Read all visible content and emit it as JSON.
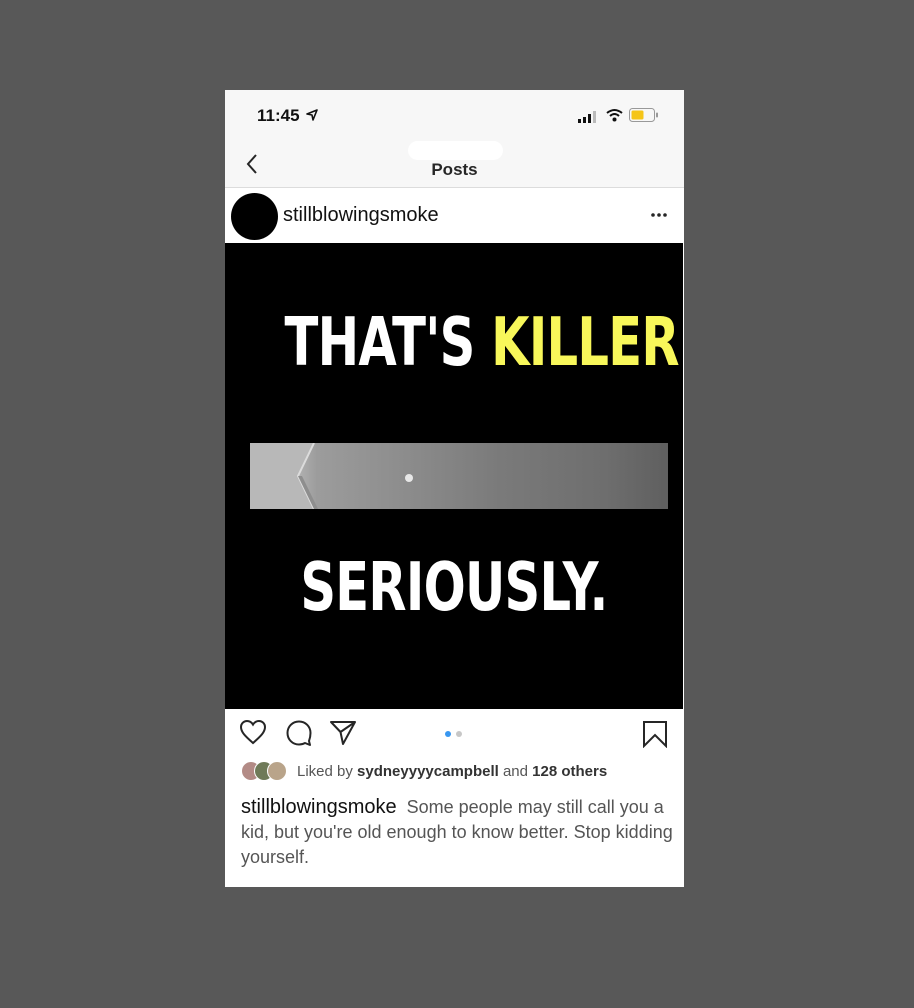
{
  "status_bar": {
    "time": "11:45"
  },
  "nav": {
    "title": "Posts"
  },
  "post": {
    "username": "stillblowingsmoke",
    "image": {
      "headline_part1": "THAT'S ",
      "headline_highlight": "KILLER",
      "headline_end": ".",
      "headline2": "SERIOUSLY."
    },
    "likes": {
      "prefix": "Liked by ",
      "user": "sydneyyyycampbell",
      "middle": " and ",
      "others": "128 others"
    },
    "caption": {
      "user": "stillblowingsmoke",
      "text": "Some people may still call you a kid, but you're old enough to know better. Stop kidding yourself."
    }
  },
  "colors": {
    "background": "#585858",
    "highlight": "#f8f75a",
    "active_dot": "#3897f0",
    "battery": "#f5c518"
  },
  "icons": [
    "location-arrow-icon",
    "signal-icon",
    "wifi-icon",
    "battery-icon",
    "back-chevron-icon",
    "more-dots-icon",
    "heart-icon",
    "comment-icon",
    "share-icon",
    "bookmark-icon"
  ],
  "carousel": {
    "count": 2,
    "active": 1
  }
}
